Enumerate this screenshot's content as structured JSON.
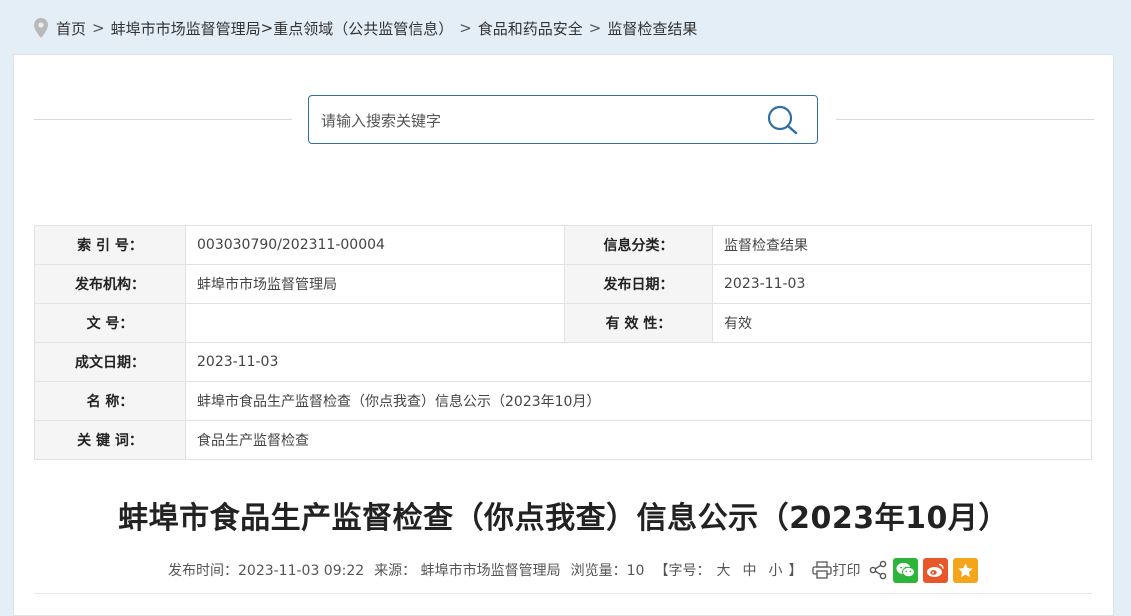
{
  "breadcrumb": {
    "items": [
      "首页",
      "蚌埠市市场监督管理局",
      "重点领域（公共监管信息）",
      "食品和药品安全",
      "监督检查结果"
    ],
    "seps": [
      ">",
      ">",
      ">",
      ">"
    ]
  },
  "search": {
    "placeholder": "请输入搜索关键字",
    "value": ""
  },
  "meta": {
    "index_label": "索 引 号：",
    "index_value": "003030790/202311-00004",
    "category_label": "信息分类：",
    "category_value": "监督检查结果",
    "publisher_label": "发布机构：",
    "publisher_value": "蚌埠市市场监督管理局",
    "pubdate_label": "发布日期：",
    "pubdate_value": "2023-11-03",
    "docno_label": "文 号：",
    "docno_value": "",
    "validity_label": "有 效 性：",
    "validity_value": "有效",
    "created_label": "成文日期：",
    "created_value": "2023-11-03",
    "name_label": "名 称：",
    "name_value": "蚌埠市食品生产监督检查（你点我查）信息公示（2023年10月）",
    "keywords_label": "关 键 词：",
    "keywords_value": "食品生产监督检查"
  },
  "article": {
    "title": "蚌埠市食品生产监督检查（你点我查）信息公示（2023年10月）"
  },
  "info": {
    "time": "发布时间：2023-11-03 09:22",
    "source": "来源：  蚌埠市市场监督管理局",
    "views": "浏览量：10",
    "fontsize_open": "【字号：",
    "size_large": "大",
    "size_medium": "中",
    "size_small": "小",
    "fontsize_close": "】",
    "print": "打印"
  },
  "colors": {
    "accent": "#2f6fa5",
    "wechat": "#2cb53a",
    "weibo": "#e8562b",
    "favorite": "#f4a51c"
  },
  "icons": [
    "location-pin-icon",
    "search-icon",
    "printer-icon",
    "share-icon",
    "wechat-icon",
    "weibo-icon",
    "star-icon"
  ]
}
